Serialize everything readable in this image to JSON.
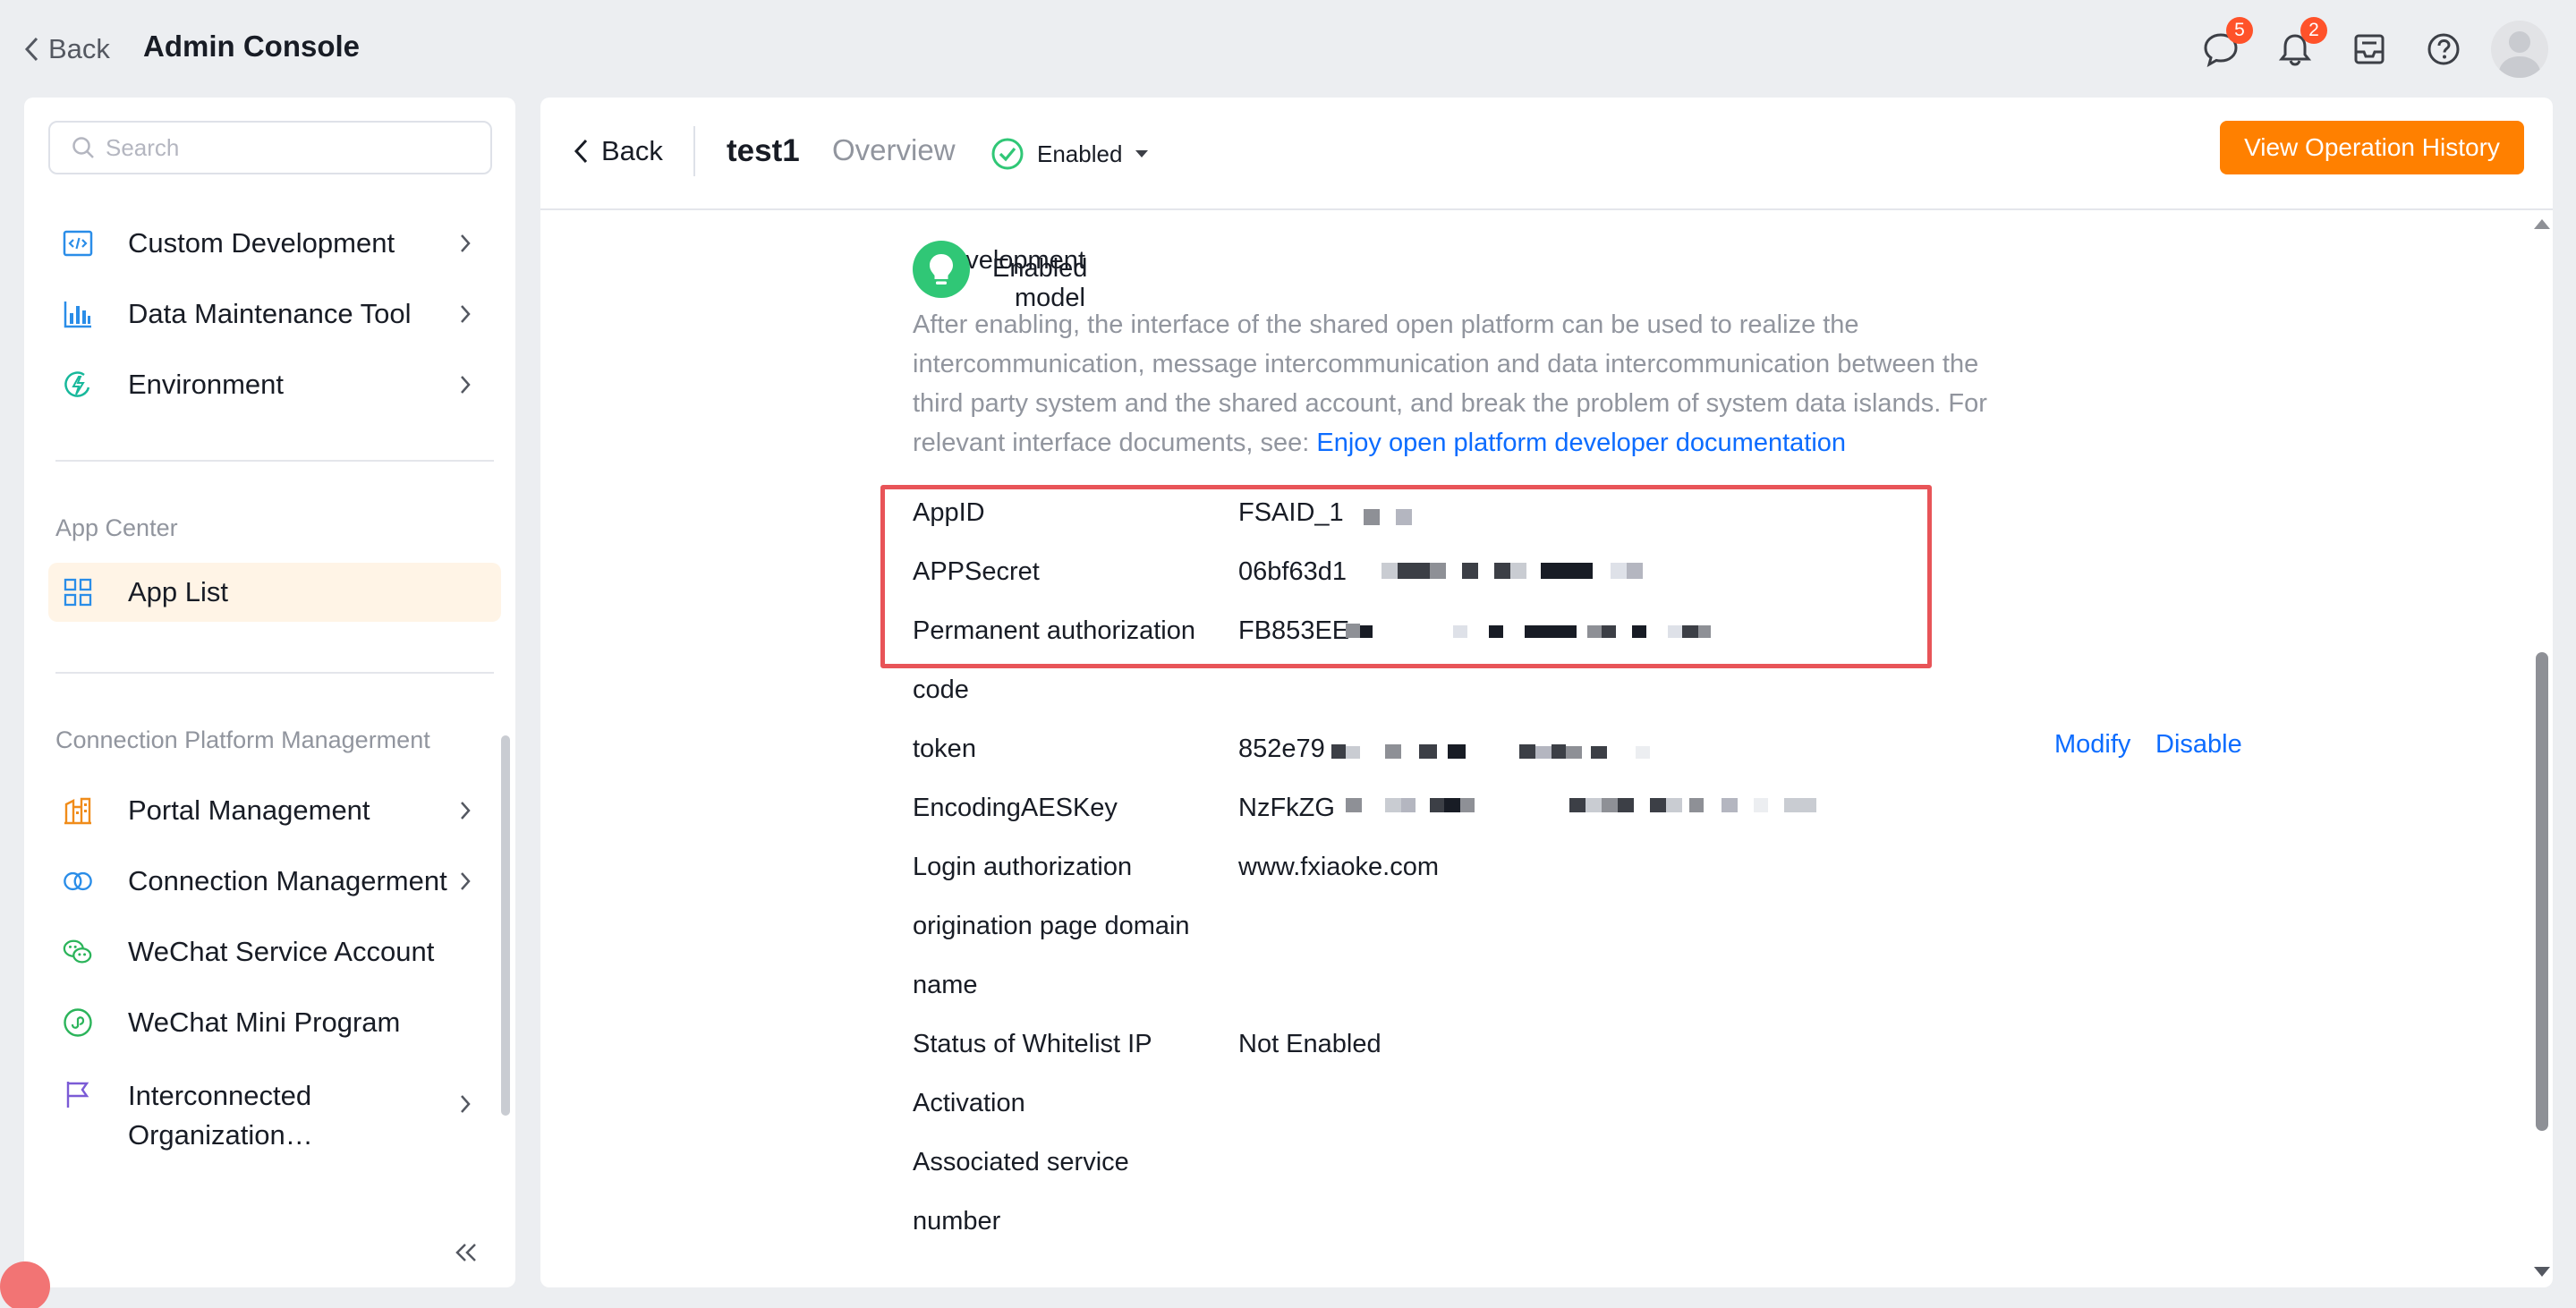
{
  "topbar": {
    "back_label": "Back",
    "title": "Admin Console",
    "messages_badge": "5",
    "notifications_badge": "2"
  },
  "sidebar": {
    "search_placeholder": "Search",
    "items_top": [
      {
        "label": "Custom Development",
        "icon": "code-window-icon"
      },
      {
        "label": "Data Maintenance Tool",
        "icon": "bar-chart-icon"
      },
      {
        "label": "Environment",
        "icon": "environment-icon"
      }
    ],
    "app_center_title": "App Center",
    "app_list_label": "App List",
    "connection_title": "Connection Platform Managerment",
    "items_connection": [
      {
        "label": "Portal Management",
        "icon": "building-icon"
      },
      {
        "label": "Connection Managerment",
        "icon": "linked-circles-icon"
      },
      {
        "label": "WeChat Service Account",
        "icon": "wechat-icon"
      },
      {
        "label": "WeChat Mini Program",
        "icon": "mini-program-icon"
      },
      {
        "label": "Interconnected Organization…",
        "icon": "flag-icon"
      }
    ]
  },
  "main": {
    "back_label": "Back",
    "app_name": "test1",
    "overview_label": "Overview",
    "status_label": "Enabled",
    "history_button": "View Operation History",
    "dev_model_label_1": "Development",
    "dev_model_label_2": "model",
    "dev_model_status": "Enabled",
    "description": "After enabling, the interface of the shared open platform can be used to realize the intercommunication, message intercommunication and data intercommunication between the third party system and the shared account, and break the problem of system data islands. For relevant interface documents, see: ",
    "doc_link": "Enjoy open platform developer documentation",
    "rows": [
      {
        "label": "AppID",
        "value": "FSAID_1"
      },
      {
        "label": "APPSecret",
        "value": "06bf63d1"
      },
      {
        "label": "Permanent authorization",
        "value": "FB853EE"
      },
      {
        "label": "code",
        "value": ""
      },
      {
        "label": "token",
        "value": "852e79"
      },
      {
        "label": "EncodingAESKey",
        "value": "NzFkZG"
      },
      {
        "label": "Login authorization",
        "value": "www.fxiaoke.com"
      },
      {
        "label": "origination page domain",
        "value": ""
      },
      {
        "label": "name",
        "value": ""
      },
      {
        "label": "Status of Whitelist IP",
        "value": "Not Enabled"
      },
      {
        "label": "Activation",
        "value": ""
      },
      {
        "label": "Associated service",
        "value": ""
      },
      {
        "label": "number",
        "value": ""
      }
    ],
    "modify_label": "Modify",
    "disable_label": "Disable"
  },
  "colors": {
    "accent_orange": "#ff8000",
    "link_blue": "#0c6cff",
    "success_green": "#30c776",
    "highlight_red": "#e85458",
    "badge_red": "#ff522a"
  }
}
